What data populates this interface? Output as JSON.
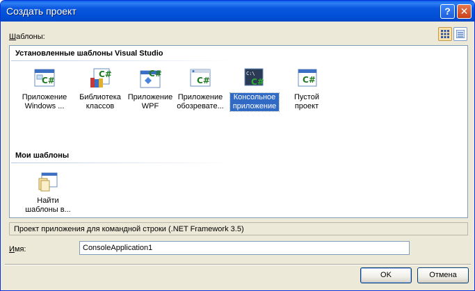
{
  "window": {
    "title": "Создать проект"
  },
  "title_buttons": {
    "help": "?",
    "close": "✕"
  },
  "templates_label": {
    "accel": "Ш",
    "rest": "аблоны:"
  },
  "view_buttons": [
    "large-icons-view-icon",
    "small-icons-view-icon"
  ],
  "groups": [
    {
      "title": "Установленные шаблоны Visual Studio",
      "items": [
        {
          "label": "Приложение Windows ...",
          "icon": "windows-forms-csharp-icon",
          "selected": false
        },
        {
          "label": "Библиотека классов",
          "icon": "class-library-csharp-icon",
          "selected": false
        },
        {
          "label": "Приложение WPF",
          "icon": "wpf-csharp-icon",
          "selected": false
        },
        {
          "label": "Приложение обозревате...",
          "icon": "browser-app-csharp-icon",
          "selected": false
        },
        {
          "label": "Консольное приложение",
          "icon": "console-app-csharp-icon",
          "selected": true
        },
        {
          "label": "Пустой проект",
          "icon": "empty-project-csharp-icon",
          "selected": false
        }
      ]
    },
    {
      "title": "Мои шаблоны",
      "items": [
        {
          "label": "Найти шаблоны в...",
          "icon": "search-templates-icon",
          "selected": false
        }
      ]
    }
  ],
  "csharp_glyph": "C#",
  "console_glyph": "C:\\",
  "status": "Проект приложения для командной строки (.NET Framework 3.5)",
  "name_field": {
    "label_accel": "И",
    "label_rest": "мя:",
    "value": "ConsoleApplication1"
  },
  "buttons": {
    "ok": "OK",
    "cancel": "Отмена"
  },
  "colors": {
    "title_bar": "#0250d8",
    "selection": "#316ac5",
    "dialog_bg": "#ece9d8",
    "csharp_green": "#1f7a1f"
  }
}
